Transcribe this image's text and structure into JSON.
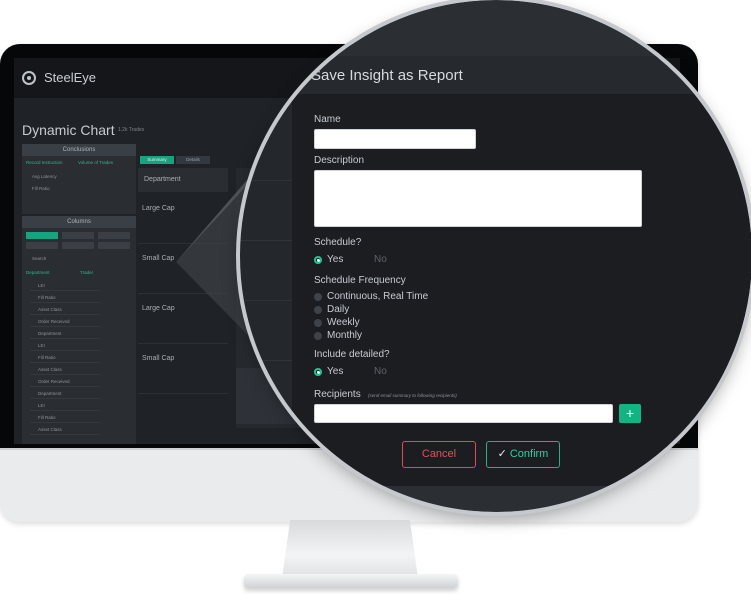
{
  "app": {
    "name": "SteelEye",
    "page_title": "Dynamic Chart",
    "page_subtitle": "1.2k Trades"
  },
  "sidebar": {
    "conclusions_header": "Conclusions",
    "conclusion_tags": [
      "Record Instruction",
      "Volume of Trades"
    ],
    "conclusion_items": [
      "Avg Latency",
      "Fill Ratio"
    ],
    "columns_header": "Columns",
    "search_placeholder": "Search",
    "column_tags": [
      "Department",
      "Trader"
    ],
    "column_items": [
      "LEI",
      "Fill Ratio",
      "Asset Class",
      "Order Received",
      "Department",
      "LEI",
      "Fill Ratio",
      "Asset Class",
      "Order Received",
      "Department",
      "LEI",
      "Fill Ratio",
      "Asset Class"
    ]
  },
  "grid": {
    "tabs": [
      "Summary",
      "Details"
    ],
    "header": "Department",
    "rows": [
      "Large Cap",
      "Small Cap",
      "Large Cap",
      "Small Cap"
    ]
  },
  "modal": {
    "title": "Save Insight as Report",
    "name_label": "Name",
    "name_value": "",
    "description_label": "Description",
    "description_value": "",
    "schedule_label": "Schedule?",
    "schedule_options": [
      "Yes",
      "No"
    ],
    "schedule_selected": "Yes",
    "frequency_label": "Schedule Frequency",
    "frequency_options": [
      "Continuous, Real Time",
      "Daily",
      "Weekly",
      "Monthly"
    ],
    "detailed_label": "Include detailed?",
    "detailed_options": [
      "Yes",
      "No"
    ],
    "detailed_selected": "Yes",
    "recipients_label": "Recipients",
    "recipients_hint": "(send email summary to following recipients)",
    "recipients_value": "",
    "add_label": "+",
    "cancel_label": "Cancel",
    "confirm_label": "Confirm"
  },
  "colors": {
    "accent": "#12b482",
    "danger": "#e04a58",
    "modal_bg": "#1b1d21"
  },
  "icons": {
    "logo": "steeleye-logo-icon",
    "confirm": "check-icon",
    "add": "plus-icon"
  }
}
